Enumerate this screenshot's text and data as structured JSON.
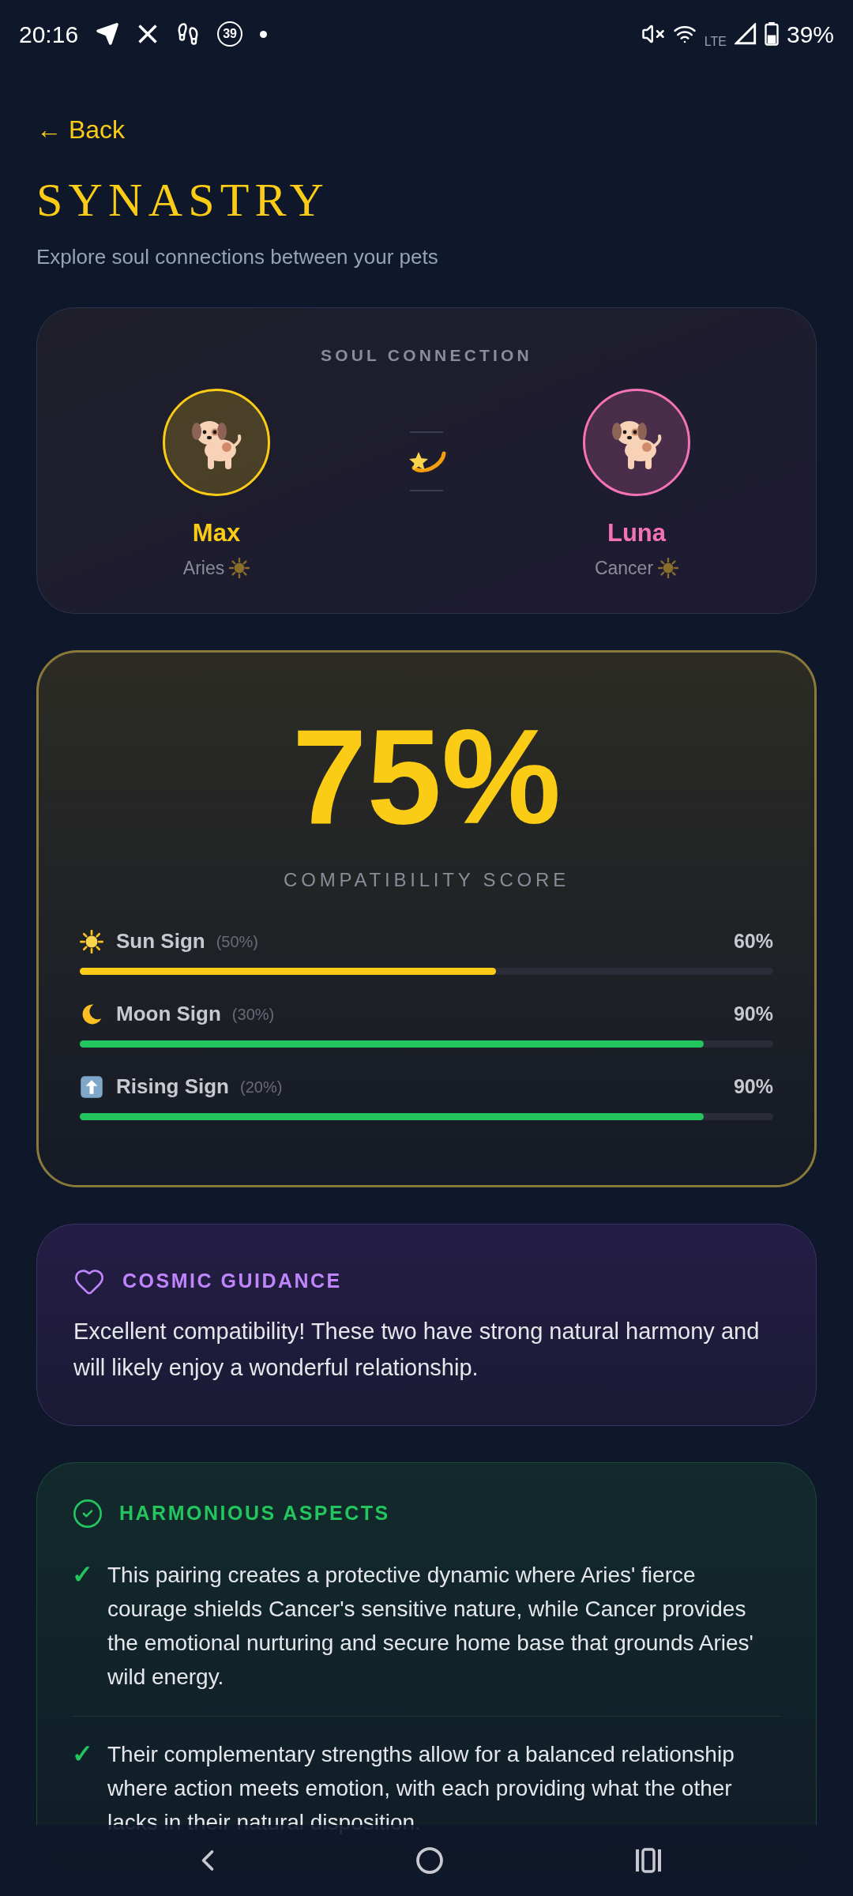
{
  "status_bar": {
    "time": "20:16",
    "notification_count": "39",
    "network": "LTE",
    "battery": "39%"
  },
  "back_link": "← Back",
  "title": "SYNASTRY",
  "subtitle": "Explore soul connections between your pets",
  "soul_connection": {
    "heading": "SOUL CONNECTION",
    "pets": [
      {
        "name": "Max",
        "sign": "Aries",
        "color": "#facc15"
      },
      {
        "name": "Luna",
        "sign": "Cancer",
        "color": "#f472b6"
      }
    ]
  },
  "score": {
    "value": "75%",
    "label": "COMPATIBILITY SCORE",
    "factors": [
      {
        "kind": "sun",
        "name": "Sun Sign",
        "weight": "(50%)",
        "reading": "60%",
        "level": 0.6,
        "color": "#facc15"
      },
      {
        "kind": "moon",
        "name": "Moon Sign",
        "weight": "(30%)",
        "reading": "90%",
        "level": 0.9,
        "color": "#22c55e"
      },
      {
        "kind": "rising",
        "name": "Rising Sign",
        "weight": "(20%)",
        "reading": "90%",
        "level": 0.9,
        "color": "#22c55e"
      }
    ]
  },
  "guidance": {
    "heading": "COSMIC GUIDANCE",
    "text": "Excellent compatibility! These two have strong natural harmony and will likely enjoy a wonderful relationship."
  },
  "harmonious_aspects": {
    "heading": "HARMONIOUS ASPECTS",
    "items": [
      {
        "mark": "✓",
        "text": "This pairing creates a protective dynamic where Aries' fierce courage shields Cancer's sensitive nature, while Cancer provides the emotional nurturing and secure home base that grounds Aries' wild energy."
      },
      {
        "mark": "✓",
        "text": "Their complementary strengths allow for a balanced relationship where action meets emotion, with each providing what the other lacks in their natural disposition."
      }
    ]
  }
}
